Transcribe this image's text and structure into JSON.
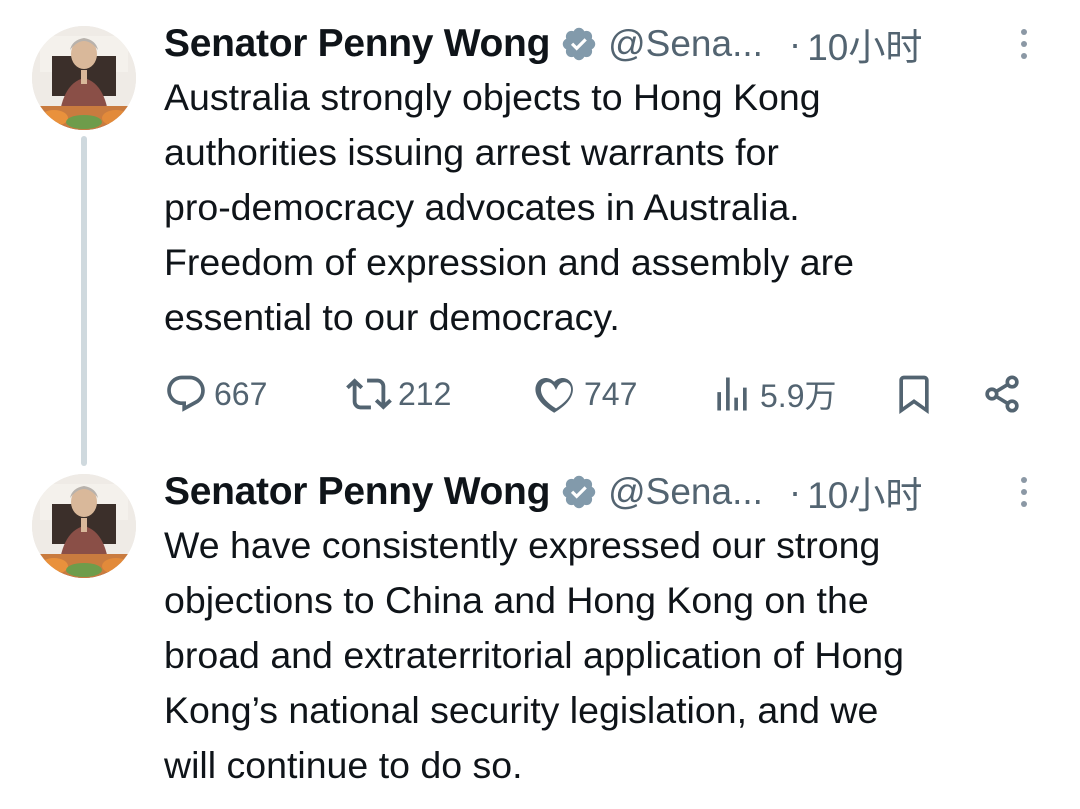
{
  "tweets": [
    {
      "author": {
        "name": "Senator Penny Wong",
        "handle": "@Sena...",
        "verified": true
      },
      "separator": "·",
      "time": "10小时",
      "lines": [
        "Australia strongly objects to Hong Kong",
        "authorities issuing arrest warrants for",
        "pro-democracy advocates in Australia.",
        "Freedom of expression and assembly are",
        "essential to our democracy."
      ],
      "stats": {
        "replies": "667",
        "reposts": "212",
        "likes": "747",
        "views": "5.9万"
      }
    },
    {
      "author": {
        "name": "Senator Penny Wong",
        "handle": "@Sena...",
        "verified": true
      },
      "separator": "·",
      "time": "10小时",
      "lines": [
        "We have consistently expressed our strong",
        "objections to China and Hong Kong on the",
        "broad and extraterritorial application of Hong",
        "Kong’s national security legislation, and we",
        "will continue to do so."
      ]
    }
  ],
  "colors": {
    "text": "#0f1419",
    "secondary": "#536471",
    "thread": "#cfd9de",
    "verified_badge": "#829aab"
  }
}
